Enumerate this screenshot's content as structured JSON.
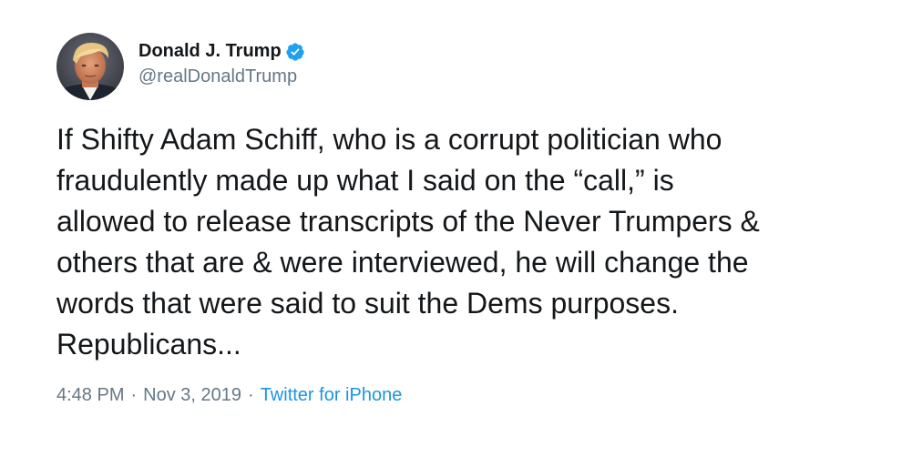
{
  "tweet": {
    "author": {
      "display_name": "Donald J. Trump",
      "handle": "@realDonaldTrump",
      "verified": true
    },
    "text_lines": [
      "If Shifty Adam Schiff, who is a corrupt politician who",
      "fraudulently made up what I said on the “call,” is",
      "allowed to release transcripts of the Never Trumpers &",
      "others that are & were interviewed, he will change the",
      "words that were said to suit the Dems purposes.",
      "Republicans..."
    ],
    "meta": {
      "time": "4:48 PM",
      "separator": "·",
      "date": "Nov 3, 2019",
      "source": "Twitter for iPhone"
    }
  },
  "colors": {
    "text": "#14171a",
    "secondary": "#657786",
    "link": "#1b95e0",
    "verified": "#1da1f2"
  },
  "icons": {
    "verified": "verified-badge-icon",
    "avatar": "profile-photo"
  }
}
